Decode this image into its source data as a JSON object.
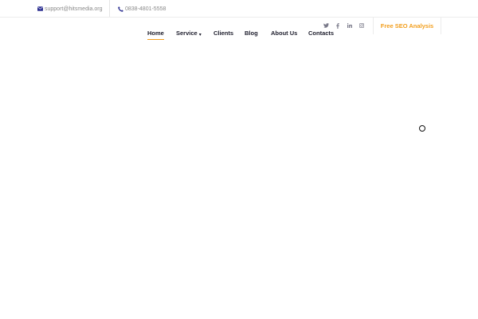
{
  "topbar": {
    "email": "support@hitsmedia.org",
    "phone": "0838-4801-5558",
    "email_icon": "envelope-icon",
    "phone_icon": "phone-icon"
  },
  "social": [
    {
      "name": "twitter",
      "icon": "twitter-icon"
    },
    {
      "name": "facebook",
      "icon": "facebook-icon"
    },
    {
      "name": "linkedin",
      "icon": "linkedin-icon"
    },
    {
      "name": "instagram",
      "icon": "instagram-icon"
    }
  ],
  "cta": {
    "label": "Free SEO Analysis"
  },
  "nav": {
    "items": [
      {
        "label": "Home",
        "active": true
      },
      {
        "label": "Service",
        "has_dropdown": true
      },
      {
        "label": "Clients"
      },
      {
        "label": "Blog"
      },
      {
        "label": "About Us"
      },
      {
        "label": "Contacts"
      }
    ],
    "dropdown_icon": "caret-down-icon"
  },
  "loader": {
    "icon": "loading-ring-icon"
  },
  "colors": {
    "accent": "#f29e1c",
    "icon_blue": "#2e3192",
    "nav_text": "#1e1e2d",
    "muted_text": "#8a8a8a"
  }
}
